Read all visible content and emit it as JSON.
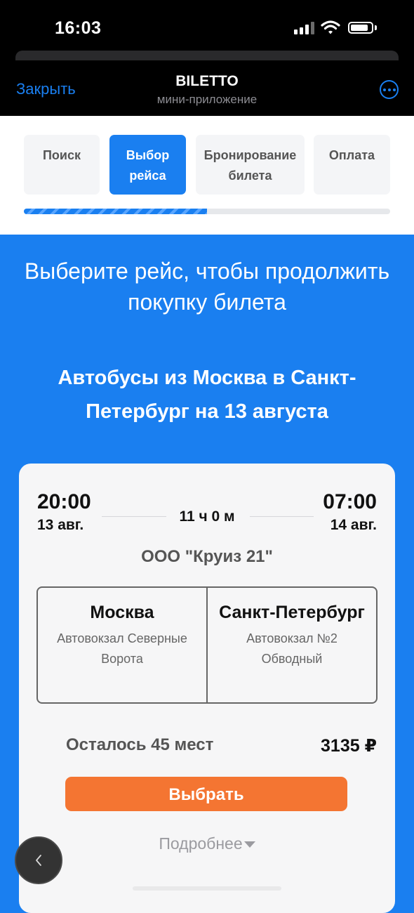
{
  "status_bar": {
    "time": "16:03"
  },
  "header": {
    "close_label": "Закрыть",
    "title": "BILETTO",
    "subtitle": "мини-приложение"
  },
  "steps": [
    {
      "label": "Поиск",
      "active": false
    },
    {
      "label": "Выбор рейса",
      "active": true
    },
    {
      "label": "Бронирование билета",
      "active": false
    },
    {
      "label": "Оплата",
      "active": false
    }
  ],
  "progress": {
    "fraction": 0.5
  },
  "main": {
    "heading": "Выберите рейс, чтобы продолжить покупку билета",
    "subheading": "Автобусы из Москва в Санкт-Петербург на 13 августа"
  },
  "trip": {
    "departure_time": "20:00",
    "departure_date": "13 авг.",
    "duration": "11 ч 0 м",
    "arrival_time": "07:00",
    "arrival_date": "14 авг.",
    "carrier": "ООО \"Круиз 21\"",
    "from_city": "Москва",
    "from_station": "Автовокзал Северные Ворота",
    "to_city": "Санкт-Петербург",
    "to_station": "Автовокзал №2 Обводный",
    "seats_left": "Осталось 45 мест",
    "price": "3135 ₽",
    "select_label": "Выбрать",
    "details_label": "Подробнее"
  },
  "colors": {
    "accent": "#1a7ff0",
    "cta": "#f47532",
    "background": "#1a7ff0"
  },
  "icons": {
    "more": "more-horizontal-icon",
    "back": "chevron-left-icon",
    "details": "caret-down-icon"
  }
}
